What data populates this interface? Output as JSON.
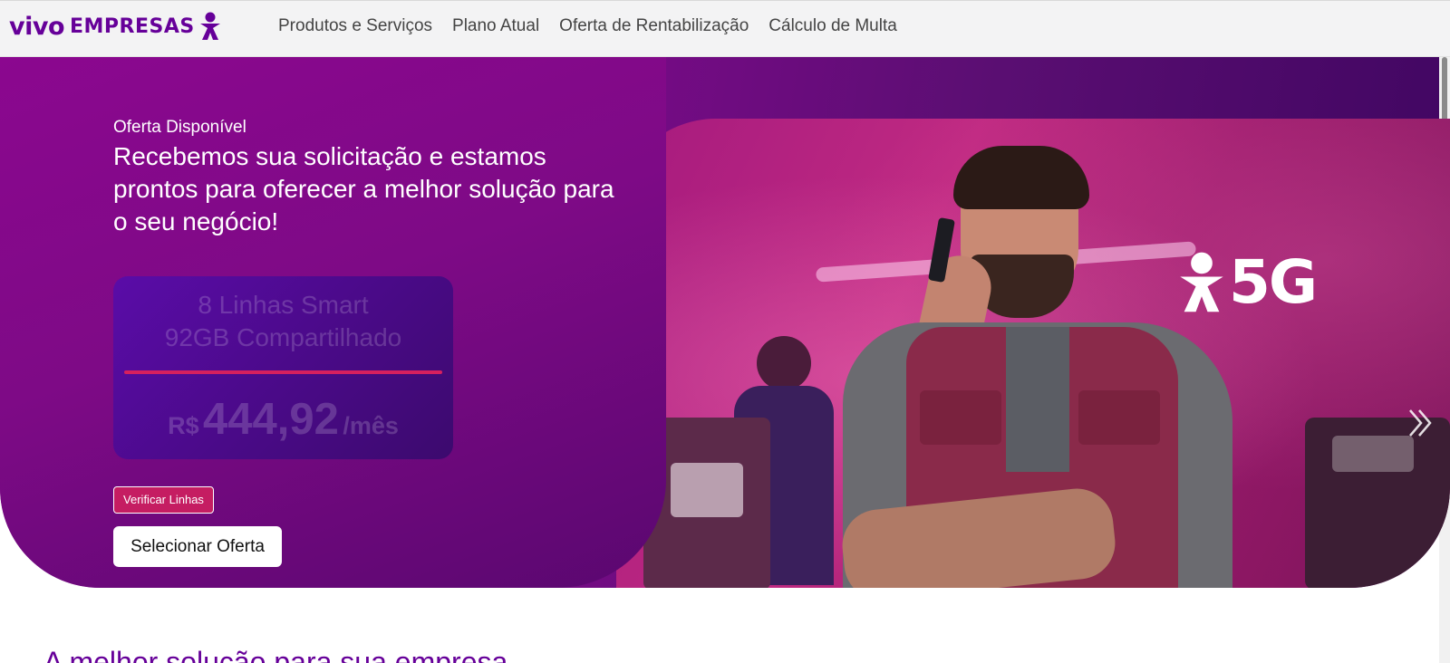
{
  "brand": {
    "logo_word": "vivo",
    "logo_suffix": "EMPRESAS",
    "color": "#660099"
  },
  "nav": {
    "items": [
      {
        "label": "Produtos e Serviços"
      },
      {
        "label": "Plano Atual"
      },
      {
        "label": "Oferta de Rentabilização"
      },
      {
        "label": "Cálculo de Multa"
      }
    ]
  },
  "hero": {
    "tag": "Oferta Disponível",
    "headline": "Recebemos sua solicitação e estamos prontos para oferecer a melhor solução para o seu negócio!",
    "offer": {
      "line1": "8 Linhas Smart",
      "line2": "92GB Compartilhado",
      "currency": "R$",
      "amount": "444,92",
      "period": "/mês"
    },
    "verify_button": "Verificar Linhas",
    "select_button": "Selecionar Oferta",
    "badge": "5G",
    "colors": {
      "accent": "#c51d62",
      "hero_bg": "#7e0a86",
      "card_bg": "#4b0a8a"
    },
    "icons": {
      "next": "chevrons-right-icon",
      "badge": "vivo-person-icon"
    }
  },
  "section": {
    "title": "A melhor solução para sua empresa"
  }
}
